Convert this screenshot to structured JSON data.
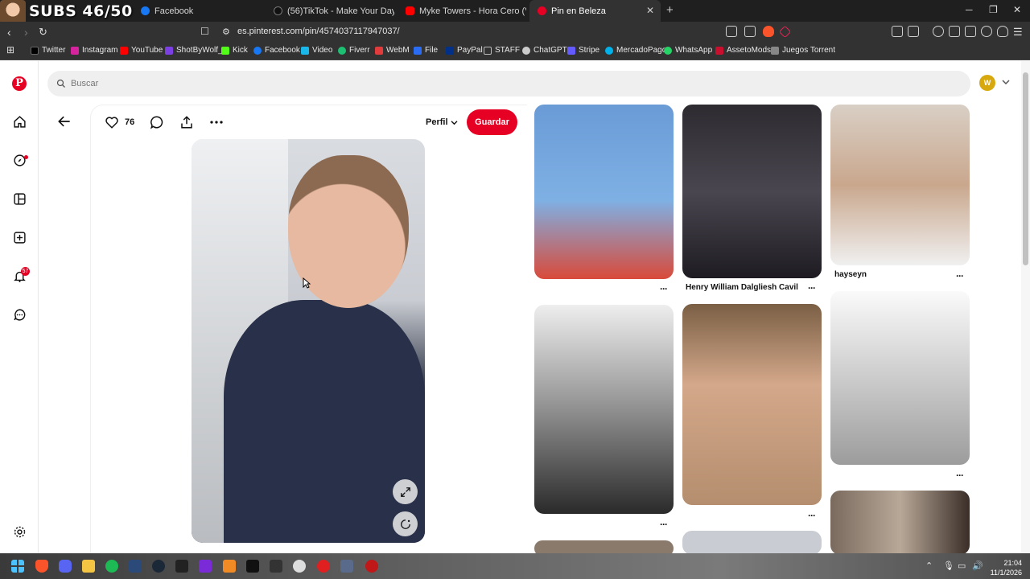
{
  "overlay": {
    "subs_text": "SUBS 46/50"
  },
  "tabs": [
    {
      "label": "Facebook",
      "favicon_color": "#1877f2",
      "active": false
    },
    {
      "label": "(56)TikTok - Make Your Day",
      "favicon_color": "#111111",
      "active": false
    },
    {
      "label": "Myke Towers - Hora Cero (Video Ofic",
      "favicon_color": "#ff0000",
      "active": false
    },
    {
      "label": "Pin en Beleza",
      "favicon_color": "#e60023",
      "active": true
    }
  ],
  "address": {
    "url": "es.pinterest.com/pin/4574037117947037/"
  },
  "bookmarks": [
    {
      "label": "Twitter",
      "color": "#000000"
    },
    {
      "label": "Instagram",
      "color": "#d6249f"
    },
    {
      "label": "YouTube",
      "color": "#ff0000"
    },
    {
      "label": "ShotByWolf_",
      "color": "#7b3fe4"
    },
    {
      "label": "Kick",
      "color": "#53fc18"
    },
    {
      "label": "Facebook",
      "color": "#1877f2"
    },
    {
      "label": "Video",
      "color": "#1ab7ea"
    },
    {
      "label": "Fiverr",
      "color": "#1dbf73"
    },
    {
      "label": "WebM",
      "color": "#e23b3b"
    },
    {
      "label": "File",
      "color": "#2a6df4"
    },
    {
      "label": "PayPal",
      "color": "#003087"
    },
    {
      "label": "STAFF",
      "color": "#bbbbbb"
    },
    {
      "label": "ChatGPT",
      "color": "#cccccc"
    },
    {
      "label": "Stripe",
      "color": "#635bff"
    },
    {
      "label": "MercadoPago",
      "color": "#00b1ea"
    },
    {
      "label": "WhatsApp",
      "color": "#25d366"
    },
    {
      "label": "AssetoMods",
      "color": "#c8102e"
    },
    {
      "label": "Juegos Torrent",
      "color": "#888888"
    }
  ],
  "header": {
    "search_placeholder": "Buscar",
    "avatar_letter": "W"
  },
  "sidebar": {
    "notifications_count": "57"
  },
  "pin": {
    "likes": "76",
    "perfil_label": "Perfil",
    "save_label": "Guardar"
  },
  "grid": [
    {
      "label": "",
      "color": "#6a9bd6"
    },
    {
      "label": "Henry William Dalgliesh Cavil",
      "color": "#3c3a3f"
    },
    {
      "label": "hayseyn",
      "color": "#d9cfc5"
    },
    {
      "label": "",
      "color": "#9a9a9a"
    },
    {
      "label": "",
      "color": "#b48e6e"
    },
    {
      "label": "",
      "color": "#c7c7c7"
    },
    {
      "label": "",
      "color": "#7a6a5e"
    }
  ],
  "taskbar": {
    "time": "21:04",
    "date": "11/1/2026"
  },
  "colors": {
    "brand": "#e60023",
    "chrome_dark": "#1f1f1f"
  }
}
